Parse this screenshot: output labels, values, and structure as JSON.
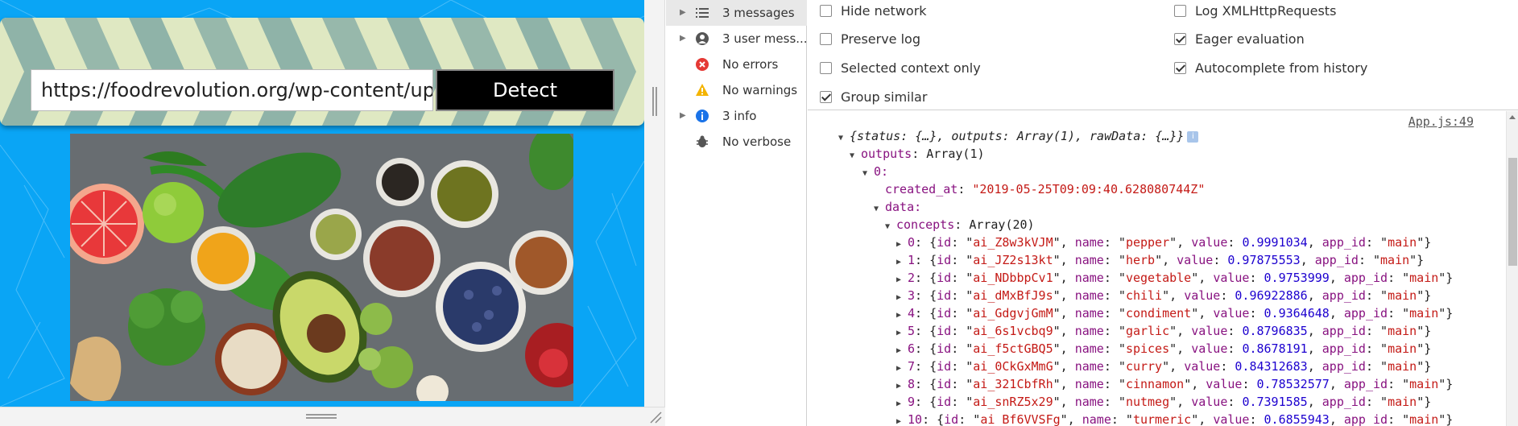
{
  "app": {
    "url_value": "https://foodrevolution.org/wp-content/uploads",
    "detect_label": "Detect",
    "image_alt": "vegetables, fruits, nuts and spices on a table"
  },
  "devtools": {
    "sidebar": [
      {
        "label": "3 messages",
        "icon": "list-icon",
        "expandable": true,
        "selected": true
      },
      {
        "label": "3 user mess...",
        "icon": "user-icon",
        "expandable": true,
        "selected": false
      },
      {
        "label": "No errors",
        "icon": "error-icon",
        "expandable": false,
        "selected": false
      },
      {
        "label": "No warnings",
        "icon": "warning-icon",
        "expandable": false,
        "selected": false
      },
      {
        "label": "3 info",
        "icon": "info-icon",
        "expandable": true,
        "selected": false
      },
      {
        "label": "No verbose",
        "icon": "bug-icon",
        "expandable": false,
        "selected": false
      }
    ],
    "settings": [
      {
        "label": "Hide network",
        "checked": false
      },
      {
        "label": "Preserve log",
        "checked": false
      },
      {
        "label": "Selected context only",
        "checked": false
      },
      {
        "label": "Group similar",
        "checked": true
      },
      {
        "label": "Log XMLHttpRequests",
        "checked": false
      },
      {
        "label": "Eager evaluation",
        "checked": true
      },
      {
        "label": "Autocomplete from history",
        "checked": true
      }
    ],
    "console": {
      "source": "App.js:49",
      "summary": "{status: {…}, outputs: Array(1), rawData: {…}}",
      "outputs_key": "outputs",
      "outputs_val": "Array(1)",
      "index0": "0:",
      "created_at_key": "created_at",
      "created_at_val": "\"2019-05-25T09:09:40.628080744Z\"",
      "data_key": "data:",
      "concepts_key": "concepts",
      "concepts_val": "Array(20)",
      "concepts": [
        {
          "idx": "0",
          "id": "ai_Z8w3kVJM",
          "name": "pepper",
          "value": "0.9991034",
          "app_id": "main"
        },
        {
          "idx": "1",
          "id": "ai_JZ2s13kt",
          "name": "herb",
          "value": "0.97875553",
          "app_id": "main"
        },
        {
          "idx": "2",
          "id": "ai_NDbbpCv1",
          "name": "vegetable",
          "value": "0.9753999",
          "app_id": "main"
        },
        {
          "idx": "3",
          "id": "ai_dMxBfJ9s",
          "name": "chili",
          "value": "0.96922886",
          "app_id": "main"
        },
        {
          "idx": "4",
          "id": "ai_GdgvjGmM",
          "name": "condiment",
          "value": "0.9364648",
          "app_id": "main"
        },
        {
          "idx": "5",
          "id": "ai_6s1vcbq9",
          "name": "garlic",
          "value": "0.8796835",
          "app_id": "main"
        },
        {
          "idx": "6",
          "id": "ai_f5ctGBQ5",
          "name": "spices",
          "value": "0.8678191",
          "app_id": "main"
        },
        {
          "idx": "7",
          "id": "ai_0CkGxMmG",
          "name": "curry",
          "value": "0.84312683",
          "app_id": "main"
        },
        {
          "idx": "8",
          "id": "ai_321CbfRh",
          "name": "cinnamon",
          "value": "0.78532577",
          "app_id": "main"
        },
        {
          "idx": "9",
          "id": "ai_snRZ5x29",
          "name": "nutmeg",
          "value": "0.7391585",
          "app_id": "main"
        },
        {
          "idx": "10",
          "id": "ai_Bf6VVSFg",
          "name": "turmeric",
          "value": "0.6855943",
          "app_id": "main"
        }
      ]
    }
  },
  "colors": {
    "app_background": "#0aa5f5",
    "chevron": "#8fb3a8",
    "string": "#c41a16",
    "number": "#1c00cf",
    "key": "#881280"
  }
}
